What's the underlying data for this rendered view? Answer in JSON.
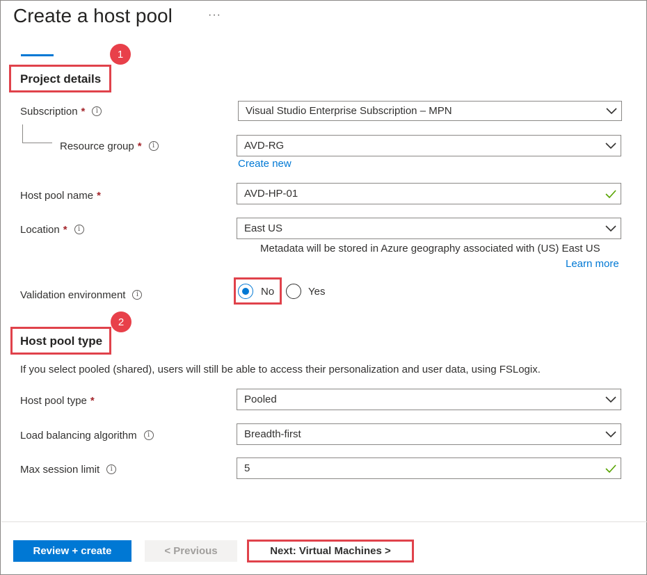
{
  "page": {
    "title": "Create a host pool",
    "more_label": "···"
  },
  "callouts": [
    "1",
    "2"
  ],
  "project_details": {
    "heading": "Project details",
    "subscription": {
      "label": "Subscription",
      "required": "*",
      "value": "Visual Studio Enterprise Subscription – MPN"
    },
    "resource_group": {
      "label": "Resource group",
      "required": "*",
      "value": "AVD-RG",
      "create_new": "Create new"
    },
    "host_pool_name": {
      "label": "Host pool name",
      "required": "*",
      "value": "AVD-HP-01"
    },
    "location": {
      "label": "Location",
      "required": "*",
      "value": "East US",
      "hint": "Metadata will be stored in Azure geography associated with (US) East US",
      "learn_more": "Learn more"
    },
    "validation_environment": {
      "label": "Validation environment",
      "options": [
        "No",
        "Yes"
      ],
      "selected": "No"
    }
  },
  "host_pool_type_section": {
    "heading": "Host pool type",
    "description": "If you select pooled (shared), users will still be able to access their personalization and user data, using FSLogix.",
    "host_pool_type": {
      "label": "Host pool type",
      "required": "*",
      "value": "Pooled"
    },
    "load_balancing": {
      "label": "Load balancing algorithm",
      "value": "Breadth-first"
    },
    "max_session_limit": {
      "label": "Max session limit",
      "value": "5"
    }
  },
  "footer": {
    "review_create": "Review + create",
    "previous": "< Previous",
    "next": "Next: Virtual Machines >"
  },
  "icons": {
    "info": "info-icon",
    "dropdown": "chevron-down-icon",
    "valid": "checkmark-icon"
  },
  "colors": {
    "accent": "#0078d4",
    "highlight": "#e0424b",
    "required": "#a4262c",
    "valid": "#57a300"
  }
}
